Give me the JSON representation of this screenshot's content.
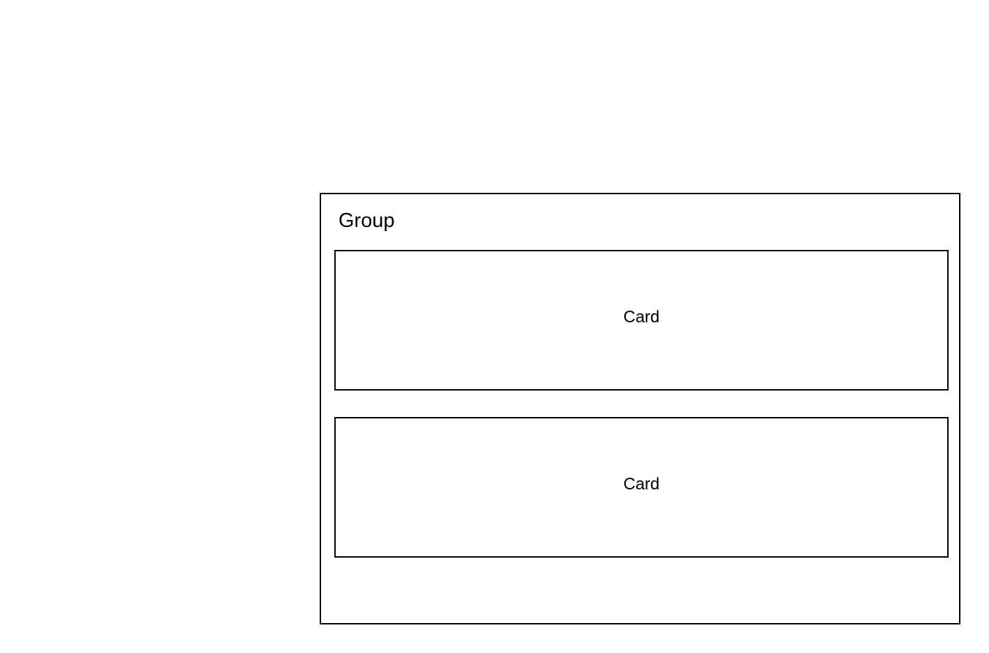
{
  "group": {
    "title": "Group",
    "cards": [
      {
        "label": "Card"
      },
      {
        "label": "Card"
      }
    ]
  }
}
